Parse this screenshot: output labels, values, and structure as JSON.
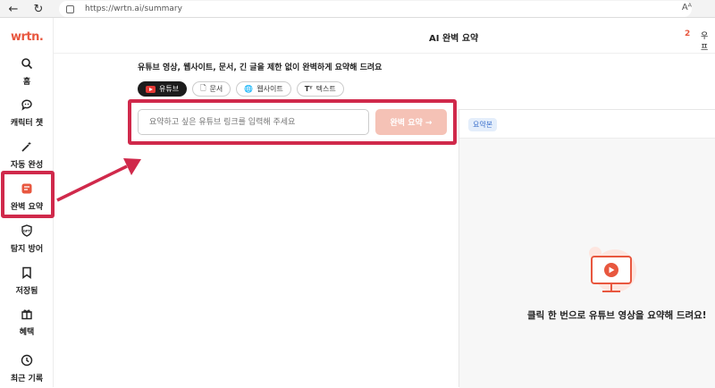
{
  "browser": {
    "url": "https://wrtn.ai/summary",
    "reader_icon": "Aᴬ"
  },
  "logo": "wrtn.",
  "sidebar": {
    "items": [
      {
        "label": "홈",
        "icon": "search-icon"
      },
      {
        "label": "캐릭터 챗",
        "icon": "chat-bubble-icon"
      },
      {
        "label": "자동 완성",
        "icon": "magic-wand-icon"
      },
      {
        "label": "완벽 요약",
        "icon": "summary-icon"
      },
      {
        "label": "탐지 방어",
        "icon": "shield-gpt-icon"
      },
      {
        "label": "저장됨",
        "icon": "bookmark-icon"
      },
      {
        "label": "혜택",
        "icon": "gift-icon"
      },
      {
        "label": "최근 기록",
        "icon": "clock-icon"
      }
    ]
  },
  "header": {
    "title": "AI 완벽 요약",
    "credit_count": "2",
    "credit_label": "우프"
  },
  "main": {
    "subtitle": "유튜브 영상, 웹사이트, 문서, 긴 글을 제한 없이 완벽하게 요약해 드려요",
    "tabs": [
      {
        "label": "유튜브",
        "icon": "youtube-icon",
        "active": true
      },
      {
        "label": "문서",
        "icon": "document-icon"
      },
      {
        "label": "웹사이트",
        "icon": "globe-icon"
      },
      {
        "label": "텍스트",
        "icon": "text-icon"
      }
    ],
    "input_placeholder": "요약하고 싶은 유튜브 링크를 입력해 주세요",
    "submit_label": "완벽 요약 →"
  },
  "result_panel": {
    "badge": "요약본",
    "empty_message": "클릭 한 번으로 유튜브 영상을 요약해 드려요!"
  },
  "colors": {
    "brand": "#e8573f",
    "highlight": "#d0294b",
    "submit_disabled": "#f5c2b6"
  }
}
